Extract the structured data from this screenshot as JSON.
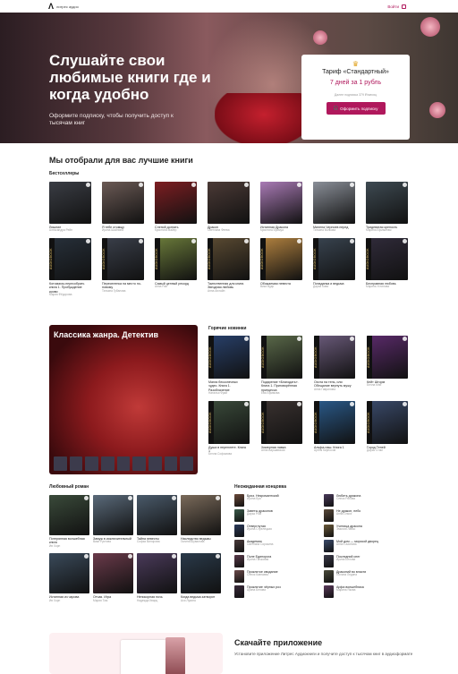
{
  "header": {
    "logo_text": "литрес аудио",
    "login_label": "Войти"
  },
  "hero": {
    "title": "Слушайте свои любимые книги где и когда удобно",
    "subtitle": "Оформите подписку, чтобы получить доступ к тысячам книг",
    "tariff": {
      "crown_icon": "crown-icon",
      "name": "Тариф «Стандартный»",
      "price": "7 дней за 1 рубль",
      "note": "Далее подписка 379 ₽/месяц",
      "button_label": "Оформить подписку"
    }
  },
  "section_title": "Мы отобрали для вас лучшие книги",
  "bestsellers": {
    "label": "Бестселлеры",
    "books": [
      {
        "title": "Лишние",
        "author": "Александра Рейн",
        "color": "#3a3d44"
      },
      {
        "title": "Я тебе отомщу",
        "author": "Ирина Шайлина",
        "color": "#6b5a55"
      },
      {
        "title": "Слепой догнать",
        "author": "Кристина Майер",
        "color": "#7d1e22"
      },
      {
        "title": "Дракон",
        "author": "Светлана Феева",
        "color": "#4b3a36"
      },
      {
        "title": "Истинная Дракона",
        "author": "Кристина Бромуа",
        "color": "#a97ab5"
      },
      {
        "title": "Милена Черноев перед",
        "author": "Татьяна Волкова",
        "color": "#8a8f98"
      },
      {
        "title": "Тридевятая крепость",
        "author": "Марина Ефиминюк",
        "color": "#3e4a52"
      },
      {
        "title": "Котомагаз-пересобрать книга 1. Пробуждение крови",
        "author": "Мария Фёдорова",
        "color": "#27303a",
        "ab": true
      },
      {
        "title": "Переселенка на место по-новому",
        "author": "Татьяна Губанова",
        "color": "#3a3f4a",
        "ab": true
      },
      {
        "title": "Самый ценный рекорд",
        "author": "Анна Рай",
        "color": "#6a7a3a",
        "ab": true
      },
      {
        "title": "Таинственная для книги. Звездная любовь",
        "author": "Анна Анлайн",
        "color": "#5a4a32",
        "ab": true
      },
      {
        "title": "Обожаемая невеста",
        "author": "Вика Вудс",
        "color": "#b1813f",
        "ab": true
      },
      {
        "title": "Попаданка и ведьма",
        "author": "Дарья Кова",
        "color": "#394450",
        "ab": true
      },
      {
        "title": "Бесправная любовь",
        "author": "Марина Устинова",
        "color": "#302b3a",
        "ab": true
      }
    ]
  },
  "promo": {
    "title": "Классика жанра. Детектив"
  },
  "hot_novelties": {
    "label": "Горячие новинки",
    "books": [
      {
        "title": "Магия бесконечных чудес. Книга 1. Разоблачение",
        "author": "Наталья Фрай",
        "color": "#28406a",
        "ab": true
      },
      {
        "title": "Подарение «Благодать». Книга 1. Приговорённая принцесса",
        "author": "Ева Ефимова",
        "color": "#5b6a4a",
        "ab": true
      },
      {
        "title": "Охота на тень, или Обещание вернуть мужу",
        "author": "Анна Гаврилова",
        "color": "#6a5a7a",
        "ab": true
      },
      {
        "title": "Кейт Шторм",
        "author": "Белла Мэй",
        "color": "#5a2a6a",
        "ab": true
      },
      {
        "title": "Душа в переплете. Книга 1",
        "author": "Белла Софомова",
        "color": "#3a4a3a",
        "ab": true
      },
      {
        "title": "Химерная лавка",
        "author": "Анна Варшавская",
        "color": "#3a3230",
        "ab": true
      },
      {
        "title": "Альфа-наш. Книга 1",
        "author": "Артём Кирносов",
        "color": "#2a5a8a",
        "ab": true
      },
      {
        "title": "Город Теней",
        "author": "Дарья Стим",
        "color": "#3a4a6a",
        "ab": true
      }
    ]
  },
  "romance": {
    "label": "Любовный роман",
    "books": [
      {
        "title": "Потерянная волшебная книга",
        "author": "Ив Хорн",
        "color": "#3a4a3a"
      },
      {
        "title": "Замуж в исключительный",
        "author": "Вики Рустова",
        "color": "#5a6a7a"
      },
      {
        "title": "Тайна невесты",
        "author": "Софья Вилорова",
        "color": "#4a5a6a"
      },
      {
        "title": "Наследство ведьмы",
        "author": "Галина Шувалова",
        "color": "#7a6a5a"
      },
      {
        "title": "Истинная из чарова",
        "author": "Ив Хорн",
        "color": "#3a4a5a"
      },
      {
        "title": "Отчая. Игра",
        "author": "Мария Том",
        "color": "#6a3a4a"
      },
      {
        "title": "Непокорная ночь",
        "author": "Надежда Кварц",
        "color": "#4a3a5a"
      },
      {
        "title": "Когда ведьма затворит",
        "author": "Ася Лукина",
        "color": "#2a3a4a"
      }
    ]
  },
  "unexpected_ending": {
    "label": "Неожиданная концовка",
    "items": [
      {
        "title": "Бриз. Некромантский",
        "author": "Ирина Буя",
        "color": "#6a4a3a"
      },
      {
        "title": "Любить дракона",
        "author": "Олеся Рябова",
        "color": "#4a3a5a"
      },
      {
        "title": "Заветы драконов",
        "author": "Дарья Ром",
        "color": "#3a5a4a"
      },
      {
        "title": "Не дракон, небо",
        "author": "Анна Ольга",
        "color": "#5a4a3a"
      },
      {
        "title": "Отвергнутая",
        "author": "Ирина Стрелецкая",
        "color": "#2a3a5a"
      },
      {
        "title": "Ученица дракона",
        "author": "Эмилия Ланко",
        "color": "#6a5a3a"
      },
      {
        "title": "Академия",
        "author": "Светлана Сорокина",
        "color": "#4a3a3a"
      },
      {
        "title": "Мой дом — морской дворец",
        "author": "Анна Сазонова",
        "color": "#3a4a6a"
      },
      {
        "title": "Поле Единорога",
        "author": "Ирина Пачковая",
        "color": "#5a3a4a"
      },
      {
        "title": "Последний снег",
        "author": "Ирина Белова",
        "color": "#3a3a4a"
      },
      {
        "title": "Проклятое свидание",
        "author": "Олеся Кавтаева",
        "color": "#6a4a4a"
      },
      {
        "title": "Драконий во власти",
        "author": "Полина Ледина",
        "color": "#4a4a3a"
      },
      {
        "title": "Проклятие чёрных роз",
        "author": "Арина Белова",
        "color": "#3a2a3a"
      },
      {
        "title": "Арфа волшебника",
        "author": "Марина Якова",
        "color": "#5a3a5a"
      }
    ]
  },
  "app": {
    "title": "Скачайте приложение",
    "subtitle": "Установите приложение Литрес Аудиокниги и получите доступ к тысячам книг в аудиоформате"
  }
}
